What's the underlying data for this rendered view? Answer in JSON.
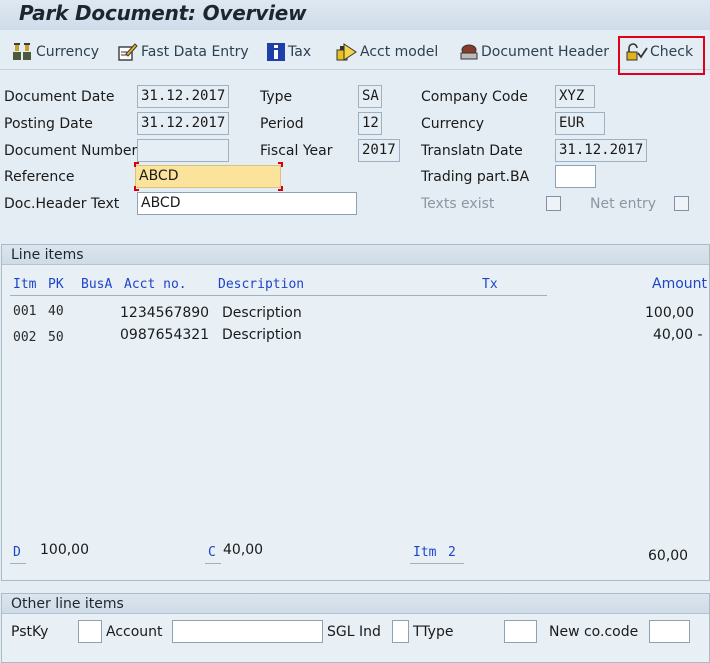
{
  "window": {
    "title": "Park Document: Overview"
  },
  "toolbar": {
    "currency": "Currency",
    "fast_data_entry": "Fast Data Entry",
    "tax": "Tax",
    "acct_model": "Acct model",
    "document_header": "Document Header",
    "check": "Check"
  },
  "header": {
    "document_date_label": "Document Date",
    "document_date": "31.12.2017",
    "posting_date_label": "Posting Date",
    "posting_date": "31.12.2017",
    "document_number_label": "Document Number",
    "document_number": "",
    "reference_label": "Reference",
    "reference": "ABCD",
    "doc_header_text_label": "Doc.Header Text",
    "doc_header_text": "ABCD",
    "type_label": "Type",
    "type": "SA",
    "period_label": "Period",
    "period": "12",
    "fiscal_year_label": "Fiscal Year",
    "fiscal_year": "2017",
    "company_code_label": "Company Code",
    "company_code": "XYZ",
    "currency_label": "Currency",
    "currency": "EUR",
    "translatn_date_label": "Translatn Date",
    "translatn_date": "31.12.2017",
    "trading_part_label": "Trading part.BA",
    "trading_part": "",
    "texts_exist_label": "Texts exist",
    "net_entry_label": "Net entry"
  },
  "line_items": {
    "title": "Line items",
    "columns": {
      "itm": "Itm",
      "pk": "PK",
      "busa": "BusA",
      "acct_no": "Acct no.",
      "description": "Description",
      "tx": "Tx",
      "amount": "Amount"
    },
    "rows": [
      {
        "itm": "001",
        "pk": "40",
        "acct_no": "1234567890",
        "description": "Description",
        "amount": "100,00"
      },
      {
        "itm": "002",
        "pk": "50",
        "acct_no": "0987654321",
        "description": "Description",
        "amount": "40,00 -"
      }
    ],
    "totals": {
      "debit_label": "D",
      "debit": "100,00",
      "credit_label": "C",
      "credit": "40,00",
      "item_label": "Itm",
      "item": "2",
      "balance": "60,00"
    }
  },
  "other_line_items": {
    "title": "Other line items",
    "pstky_label": "PstKy",
    "account_label": "Account",
    "sgl_ind_label": "SGL Ind",
    "ttype_label": "TType",
    "new_co_code_label": "New co.code"
  },
  "colors": {
    "background": "#e4edf4",
    "column_header_blue": "#1f44c8",
    "reference_highlight": "#fbe39c",
    "callout_red": "#e0001b"
  }
}
